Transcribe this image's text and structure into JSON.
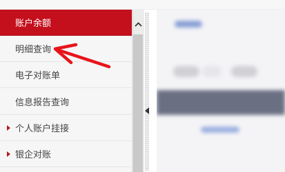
{
  "sidebar": {
    "items": [
      {
        "label": "账户余额",
        "active": true,
        "has_arrow": false
      },
      {
        "label": "明细查询",
        "active": false,
        "has_arrow": false
      },
      {
        "label": "电子对账单",
        "active": false,
        "has_arrow": false
      },
      {
        "label": "信息报告查询",
        "active": false,
        "has_arrow": false
      },
      {
        "label": "个人账户挂接",
        "active": false,
        "has_arrow": true
      },
      {
        "label": "银企对账",
        "active": false,
        "has_arrow": true
      }
    ]
  },
  "colors": {
    "active_bg": "#c4101c",
    "annotation_arrow": "#e8141b"
  },
  "icons": {
    "scroll_up": "chevron-up-icon",
    "splitter": "triangle-left-icon",
    "submenu": "triangle-right-icon",
    "annotation": "red-arrow-icon"
  }
}
